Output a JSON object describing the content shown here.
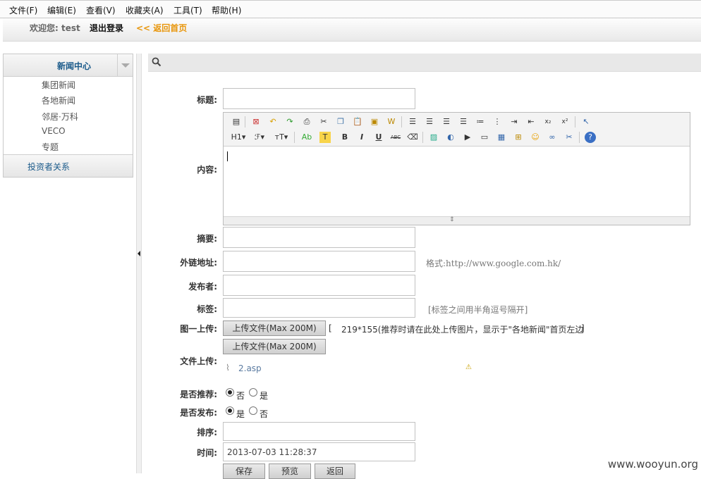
{
  "menubar": {
    "items": [
      "文件(F)",
      "编辑(E)",
      "查看(V)",
      "收藏夹(A)",
      "工具(T)",
      "帮助(H)"
    ]
  },
  "topbar": {
    "welcome": "欢迎您: test",
    "logout": "退出登录",
    "back_home": "<< 返回首页"
  },
  "sidebar": {
    "section": "新闻中心",
    "items": [
      "集团新闻",
      "各地新闻",
      "邻居·万科",
      "VECO",
      "专题"
    ],
    "footer": "投资者关系"
  },
  "form": {
    "title_label": "标题:",
    "content_label": "内容:",
    "summary_label": "摘要:",
    "link_label": "外链地址:",
    "link_hint": "格式:http://www.google.com.hk/",
    "publisher_label": "发布者:",
    "tags_label": "标签:",
    "tags_hint": "[标签之间用半角逗号隔开]",
    "image_label": "图一上传:",
    "upload_button": "上传文件(Max 200M)",
    "image_hint_open": "[",
    "image_hint": "219*155(推荐时请在此处上传图片，显示于\"各地新闻\"首页左边",
    "image_hint_close": "]",
    "file_label": "文件上传:",
    "upload_button_2": "上传文件(Max 200M)",
    "file_name": "2.asp",
    "recommend_label": "是否推荐:",
    "recommend_no": "否",
    "recommend_yes": "是",
    "publish_label": "是否发布:",
    "publish_yes": "是",
    "publish_no": "否",
    "sort_label": "排序:",
    "time_label": "时间:",
    "time_value": "2013-07-03 11:28:37",
    "save_button": "保存",
    "preview_button": "预览",
    "back_button": "返回"
  },
  "editor": {
    "row2_labels": {
      "h1": "H1▾",
      "font": "ℱ▾",
      "size": "тT▾",
      "color": "Ab",
      "highlight": "T",
      "bold": "B",
      "italic": "I",
      "underline": "U",
      "strike": "ABC"
    }
  },
  "watermark": "www.wooyun.org"
}
